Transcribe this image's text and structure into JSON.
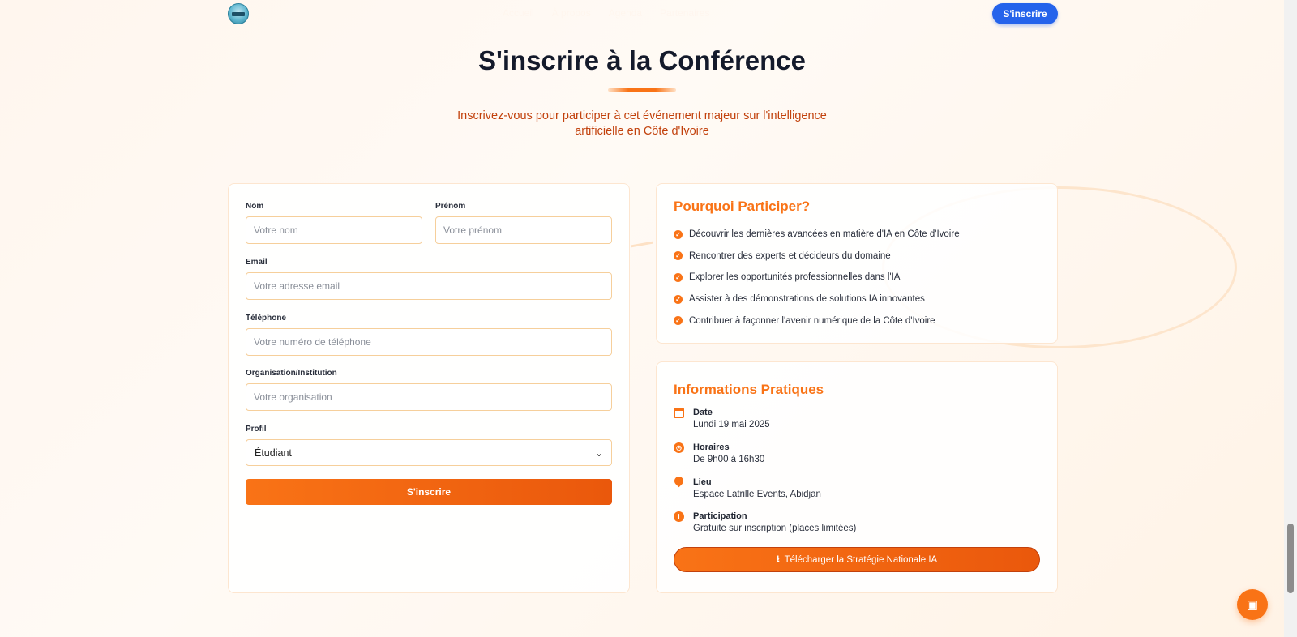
{
  "header": {
    "nav_items": [
      "Accueil",
      "À propos",
      "Agenda",
      "Partenaires"
    ],
    "cta_label": "S'inscrire"
  },
  "hero": {
    "title": "S'inscrire à la Conférence",
    "subtitle": "Inscrivez-vous pour participer à cet événement majeur sur l'intelligence artificielle en Côte d'Ivoire"
  },
  "form": {
    "nom": {
      "label": "Nom",
      "placeholder": "Votre nom"
    },
    "prenom": {
      "label": "Prénom",
      "placeholder": "Votre prénom"
    },
    "email": {
      "label": "Email",
      "placeholder": "Votre adresse email"
    },
    "telephone": {
      "label": "Téléphone",
      "placeholder": "Votre numéro de téléphone"
    },
    "organisation": {
      "label": "Organisation/Institution",
      "placeholder": "Votre organisation"
    },
    "profil": {
      "label": "Profil",
      "selected": "Étudiant"
    },
    "submit_label": "S'inscrire"
  },
  "why": {
    "title": "Pourquoi Participer?",
    "items": [
      "Découvrir les dernières avancées en matière d'IA en Côte d'Ivoire",
      "Rencontrer des experts et décideurs du domaine",
      "Explorer les opportunités professionnelles dans l'IA",
      "Assister à des démonstrations de solutions IA innovantes",
      "Contribuer à façonner l'avenir numérique de la Côte d'Ivoire"
    ]
  },
  "info": {
    "title": "Informations Pratiques",
    "date": {
      "label": "Date",
      "value": "Lundi 19 mai 2025"
    },
    "horaires": {
      "label": "Horaires",
      "value": "De 9h00 à 16h30"
    },
    "lieu": {
      "label": "Lieu",
      "value": "Espace Latrille Events, Abidjan"
    },
    "participation": {
      "label": "Participation",
      "value": "Gratuite sur inscription (places limitées)"
    },
    "download_label": "Télécharger la Stratégie Nationale IA"
  },
  "colors": {
    "accent": "#f97316",
    "accent_dark": "#ea580c",
    "primary_button": "#2563eb",
    "heading": "#141a2b"
  },
  "icons": {
    "logo": "conference-logo",
    "check": "check-circle-icon",
    "date": "calendar-icon",
    "horaires": "clock-icon",
    "lieu": "map-pin-icon",
    "participation": "info-icon",
    "download": "download-icon",
    "chat": "robot-icon"
  }
}
